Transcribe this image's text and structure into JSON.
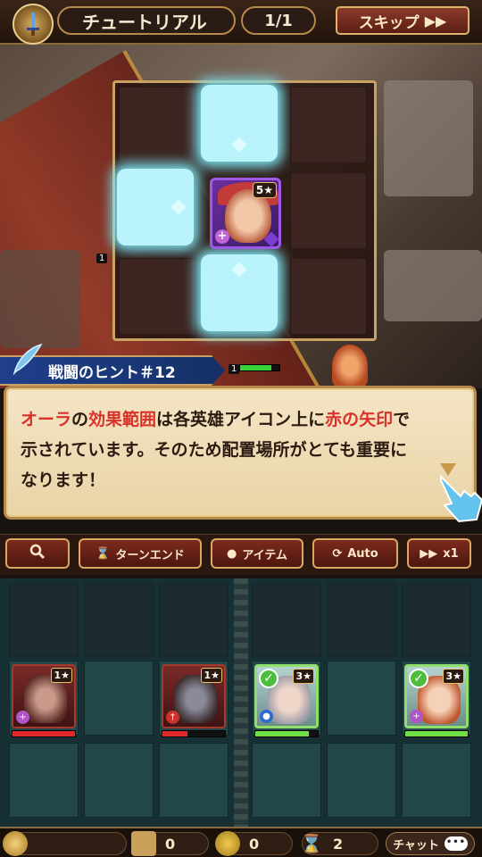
{
  "header": {
    "title": "チュートリアル",
    "page": "1/1",
    "skip_label": "スキップ"
  },
  "board_top": {
    "hero_stars": "5★",
    "level_tag_left": "1",
    "level_tag_ally": "1"
  },
  "hint": {
    "banner": "戦闘のヒント＃12",
    "line1_a": "オーラ",
    "line1_b": "の",
    "line1_c": "効果範囲",
    "line1_d": "は各英雄アイコン上に",
    "line1_e": "赤の矢印",
    "line1_f": "で",
    "line2": "示されています。そのため配置場所がとても重要に",
    "line3": "なります！"
  },
  "actions": {
    "turn_end": "ターンエンド",
    "item": "アイテム",
    "auto": "Auto",
    "speed": "x1"
  },
  "units": {
    "enemy1_stars": "1★",
    "enemy2_stars": "1★",
    "ally1_stars": "3★",
    "ally2_stars": "3★",
    "enemy1_hp": 1.0,
    "enemy2_hp": 0.4,
    "ally1_hp": 0.85,
    "ally2_hp": 1.0
  },
  "footer": {
    "cards": "0",
    "gold": "0",
    "turns": "2",
    "chat": "チャット",
    "chat_dots": "•••"
  },
  "colors": {
    "glow": "#b9f3fb",
    "hint_red": "#d8322a",
    "ally_border": "#8fe06a",
    "enemy_hp": "#e02a2a",
    "ally_hp": "#6fe043"
  }
}
